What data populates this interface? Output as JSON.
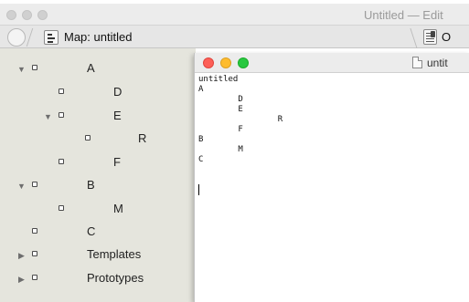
{
  "window": {
    "title": "Untitled — Edit"
  },
  "toolbar": {
    "map_tab_label": "Map: untitled",
    "right_tab_label": "O"
  },
  "outline": {
    "items": [
      {
        "label": "A",
        "disclosure": "expanded"
      },
      {
        "label": "D",
        "disclosure": "none"
      },
      {
        "label": "E",
        "disclosure": "expanded"
      },
      {
        "label": "R",
        "disclosure": "none"
      },
      {
        "label": "F",
        "disclosure": "none"
      },
      {
        "label": "B",
        "disclosure": "expanded"
      },
      {
        "label": "M",
        "disclosure": "none"
      },
      {
        "label": "C",
        "disclosure": "none"
      },
      {
        "label": "Templates",
        "disclosure": "collapsed"
      },
      {
        "label": "Prototypes",
        "disclosure": "collapsed"
      }
    ]
  },
  "preview_window": {
    "title": "untit",
    "content": "untitled\nA\n\tD\n\tE\n\t\tR\n\tF\nB\n\tM\nC"
  },
  "colors": {
    "close": "#fd5f57",
    "minimize": "#febc2e",
    "zoom": "#28c840",
    "outline_bg": "#e5e5dd"
  }
}
